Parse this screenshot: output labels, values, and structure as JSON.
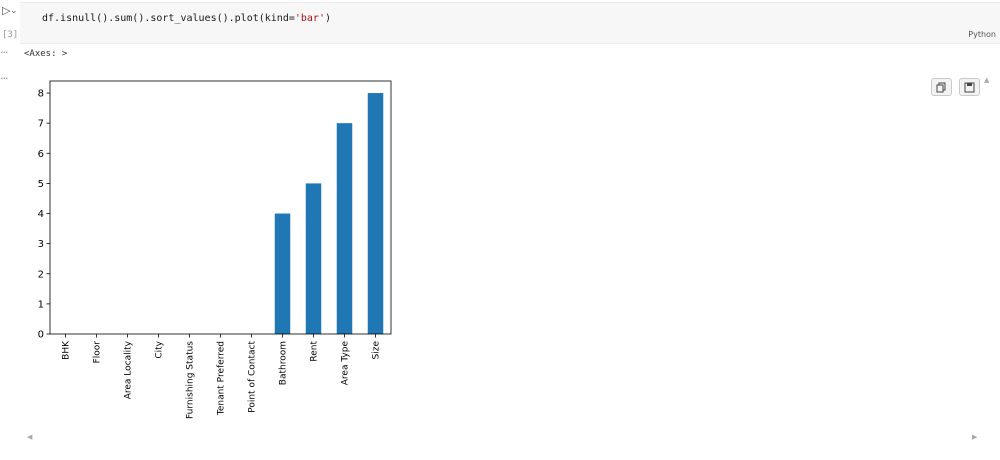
{
  "gutter": {
    "run_icon": "run-icon",
    "run_glyph": "▷",
    "chevron_glyph": "⌄",
    "execution_count": "[3]",
    "more_glyph": "···"
  },
  "cell": {
    "code_prefix": "df.isnull().sum().sort_values().plot(kind=",
    "code_string": "'bar'",
    "code_suffix": ")",
    "language": "Python"
  },
  "output": {
    "repr_text": "<Axes: >",
    "copy_icon": "copy-icon",
    "save_icon": "save-icon",
    "scroll_up_glyph": "▲",
    "scroll_left_glyph": "◀",
    "scroll_right_glyph": "▶"
  },
  "chart_data": {
    "type": "bar",
    "categories": [
      "BHK",
      "Floor",
      "Area Locality",
      "City",
      "Furnishing Status",
      "Tenant Preferred",
      "Point of Contact",
      "Bathroom",
      "Rent",
      "Area Type",
      "Size"
    ],
    "values": [
      0,
      0,
      0,
      0,
      0,
      0,
      0,
      4,
      5,
      7,
      8
    ],
    "yticks": [
      "0",
      "1",
      "2",
      "3",
      "4",
      "5",
      "6",
      "7",
      "8"
    ],
    "ylim": [
      0,
      8.4
    ],
    "grid": false,
    "bar_color": "#1f77b4"
  }
}
